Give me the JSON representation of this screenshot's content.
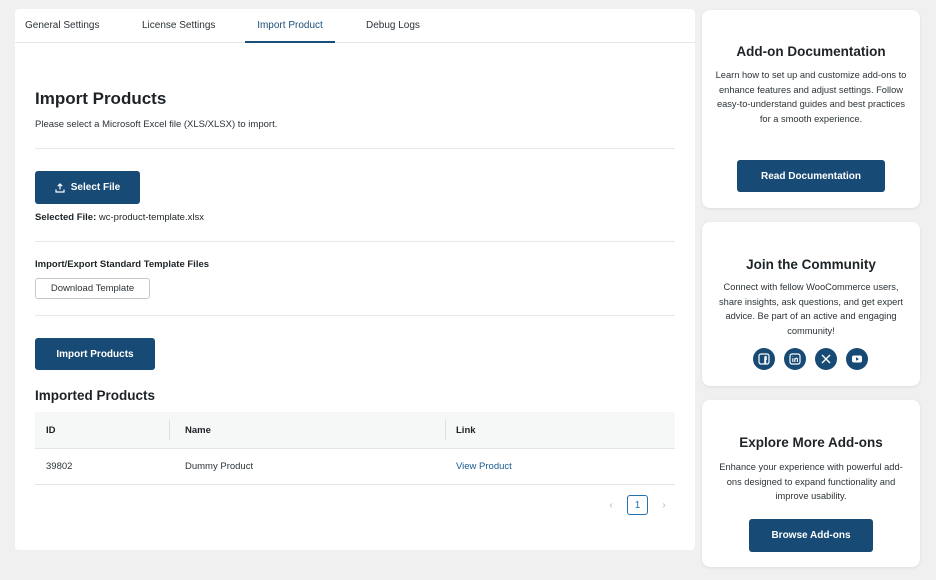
{
  "tabs": [
    "General Settings",
    "License Settings",
    "Import Product",
    "Debug Logs"
  ],
  "main": {
    "title": "Import Products",
    "description": "Please select a Microsoft Excel file (XLS/XLSX) to import.",
    "select_file_label": "Select File",
    "selected_file_label": "Selected File:",
    "selected_file_name": "wc-product-template.xlsx",
    "template_section_label": "Import/Export Standard Template Files",
    "download_template_label": "Download Template",
    "import_button_label": "Import Products",
    "imported_title": "Imported Products",
    "table": {
      "headers": [
        "ID",
        "Name",
        "Link"
      ],
      "rows": [
        {
          "id": "39802",
          "name": "Dummy Product",
          "link": "View Product"
        }
      ]
    },
    "pagination": {
      "prev": "‹",
      "current": "1",
      "next": "›"
    }
  },
  "sidebar": {
    "docs": {
      "title": "Add-on Documentation",
      "text": "Learn how to set up and customize add-ons to enhance features and adjust settings. Follow easy-to-understand guides and best practices for a smooth experience.",
      "button": "Read Documentation"
    },
    "community": {
      "title": "Join the Community",
      "text": "Connect with fellow WooCommerce users, share insights, ask questions, and get expert advice. Be part of an active and engaging community!",
      "icons": [
        "facebook-icon",
        "linkedin-icon",
        "x-icon",
        "youtube-icon"
      ]
    },
    "addons": {
      "title": "Explore More Add-ons",
      "text": "Enhance your experience with powerful add-ons designed to expand functionality and improve usability.",
      "button": "Browse Add-ons"
    }
  },
  "colors": {
    "primary": "#174a74",
    "link": "#1a5a8e",
    "background": "#f0f0f1"
  }
}
